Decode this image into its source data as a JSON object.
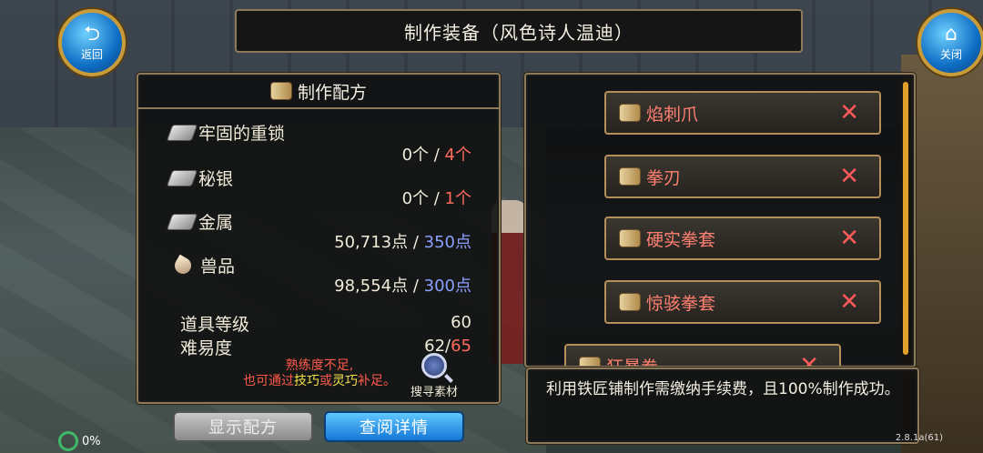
{
  "title": "制作装备（风色诗人温迪）",
  "nav": {
    "back_label": "返回",
    "close_label": "关闭"
  },
  "recipe": {
    "header": "制作配方",
    "materials": [
      {
        "name": "牢固的重锁",
        "have": "0个",
        "sep": " / ",
        "need": "4个"
      },
      {
        "name": "秘银",
        "have": "0个",
        "sep": " / ",
        "need": "1个"
      },
      {
        "name": "金属",
        "have": "50,713点",
        "sep": " / ",
        "need": "350点"
      },
      {
        "name": "兽品",
        "have": "98,554点",
        "sep": " / ",
        "need": "300点"
      }
    ],
    "item_level_label": "道具等级",
    "item_level_value": "60",
    "difficulty_label": "难易度",
    "difficulty_have": "62/",
    "difficulty_need": "65",
    "warn_line1": "熟练度不足,",
    "warn_line2_a": "也可通过",
    "warn_skill": "技巧",
    "warn_or": "或",
    "warn_dex": "灵巧",
    "warn_line2_b": "补足。",
    "search_label": "搜寻素材"
  },
  "buttons": {
    "show_recipe": "显示配方",
    "view_detail": "查阅详情"
  },
  "list": {
    "items": [
      {
        "name": "焰刺爪"
      },
      {
        "name": "拳刃"
      },
      {
        "name": "硬实拳套"
      },
      {
        "name": "惊骇拳套"
      },
      {
        "name": "狂暴拳"
      }
    ],
    "remove_glyph": "✕"
  },
  "info": "利用铁匠铺制作需缴纳手续费，且100%制作成功。",
  "hud": {
    "percent": "0%",
    "version": "2.8.1a(61)"
  },
  "colors": {
    "need_red": "#ff6a5a",
    "need_blue": "#8aa0ff",
    "frame": "#8c7a5a",
    "accent_blue": "#1476d6"
  }
}
